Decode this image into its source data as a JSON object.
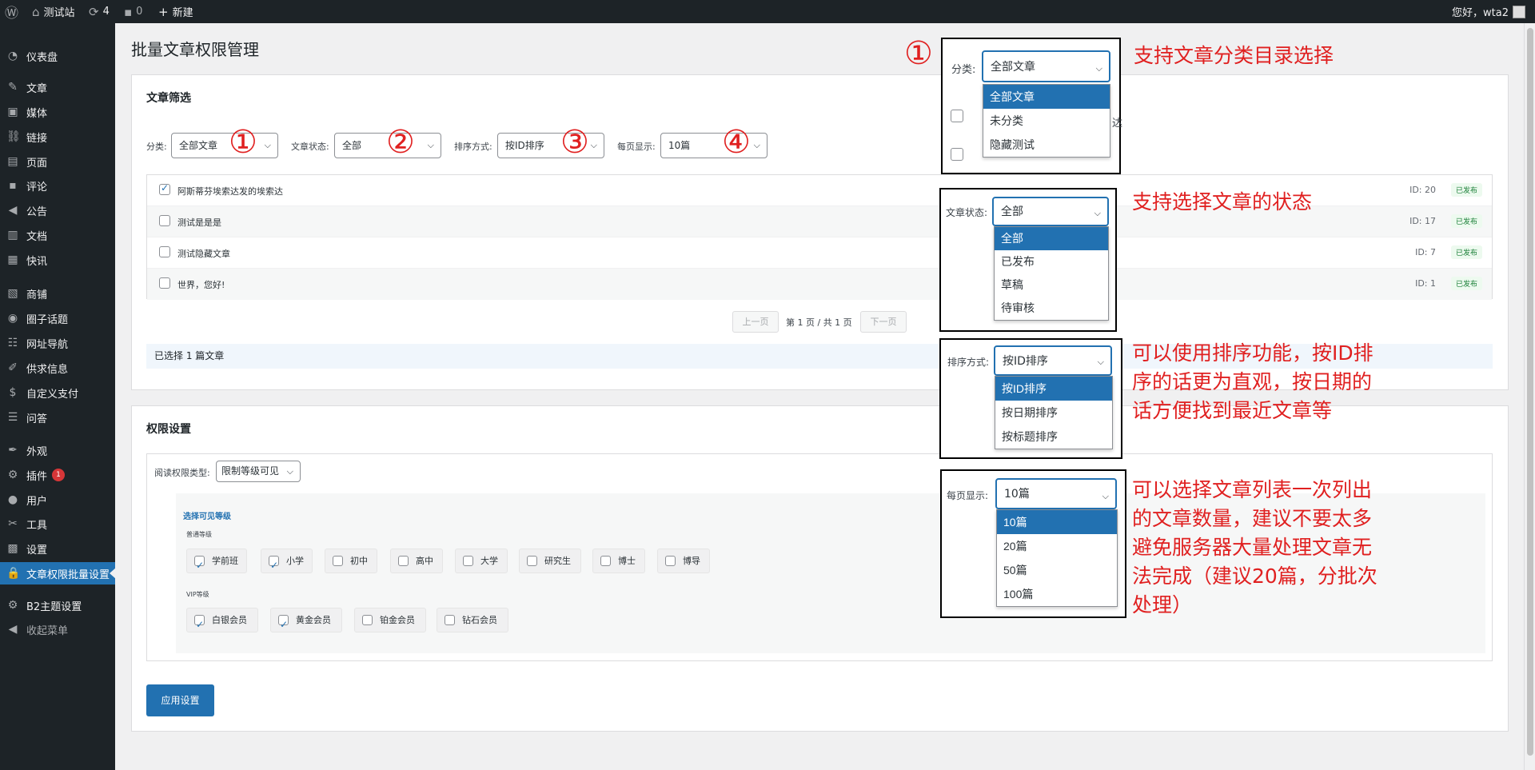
{
  "adminbar": {
    "site": "测试站",
    "updates": "4",
    "comments": "0",
    "new": "新建",
    "greeting": "您好，wta2"
  },
  "sidebar": {
    "items": [
      {
        "label": "仪表盘",
        "icon": "dashboard-icon"
      },
      {
        "label": "文章",
        "icon": "pin-icon"
      },
      {
        "label": "媒体",
        "icon": "media-icon"
      },
      {
        "label": "链接",
        "icon": "link-icon"
      },
      {
        "label": "页面",
        "icon": "page-icon"
      },
      {
        "label": "评论",
        "icon": "comment-icon"
      },
      {
        "label": "公告",
        "icon": "megaphone-icon"
      },
      {
        "label": "文档",
        "icon": "doc-icon"
      },
      {
        "label": "快讯",
        "icon": "news-icon"
      },
      {
        "label": "商铺",
        "icon": "store-icon"
      },
      {
        "label": "圈子话题",
        "icon": "circle-icon"
      },
      {
        "label": "网址导航",
        "icon": "nav-icon"
      },
      {
        "label": "供求信息",
        "icon": "supply-icon"
      },
      {
        "label": "自定义支付",
        "icon": "payment-icon"
      },
      {
        "label": "问答",
        "icon": "qa-icon"
      },
      {
        "label": "外观",
        "icon": "brush-icon"
      },
      {
        "label": "插件",
        "icon": "plugin-icon",
        "badge": "1"
      },
      {
        "label": "用户",
        "icon": "user-icon"
      },
      {
        "label": "工具",
        "icon": "wrench-icon"
      },
      {
        "label": "设置",
        "icon": "settings-icon"
      },
      {
        "label": "文章权限批量设置",
        "icon": "lock-icon"
      },
      {
        "label": "B2主题设置",
        "icon": "gear-icon"
      },
      {
        "label": "收起菜单",
        "icon": "collapse-icon"
      }
    ]
  },
  "page": {
    "title": "批量文章权限管理"
  },
  "filter": {
    "title": "文章筛选",
    "category_label": "分类:",
    "category_value": "全部文章",
    "status_label": "文章状态:",
    "status_value": "全部",
    "sort_label": "排序方式:",
    "sort_value": "按ID排序",
    "perpage_label": "每页显示:",
    "perpage_value": "10篇",
    "markers": [
      "①",
      "②",
      "③",
      "④"
    ]
  },
  "posts": [
    {
      "title": "阿斯蒂芬埃索达发的埃索达",
      "id": "ID: 20",
      "status": "已发布",
      "checked": true
    },
    {
      "title": "测试是是是",
      "id": "ID: 17",
      "status": "已发布",
      "checked": false
    },
    {
      "title": "测试隐藏文章",
      "id": "ID: 7",
      "status": "已发布",
      "checked": false
    },
    {
      "title": "世界，您好!",
      "id": "ID: 1",
      "status": "已发布",
      "checked": false
    }
  ],
  "pagination": {
    "prev": "上一页",
    "info": "第 1 页 / 共 1 页",
    "next": "下一页"
  },
  "selected_info": "已选择 1 篇文章",
  "perm": {
    "title": "权限设置",
    "type_label": "阅读权限类型:",
    "type_value": "限制等级可见",
    "levels_title": "选择可见等级",
    "normal_title": "普通等级",
    "normal": [
      {
        "label": "学前班",
        "checked": true
      },
      {
        "label": "小学",
        "checked": true
      },
      {
        "label": "初中",
        "checked": false
      },
      {
        "label": "高中",
        "checked": false
      },
      {
        "label": "大学",
        "checked": false
      },
      {
        "label": "研究生",
        "checked": false
      },
      {
        "label": "博士",
        "checked": false
      },
      {
        "label": "博导",
        "checked": false
      }
    ],
    "vip_title": "VIP等级",
    "vip": [
      {
        "label": "白银会员",
        "checked": true
      },
      {
        "label": "黄金会员",
        "checked": true
      },
      {
        "label": "铂金会员",
        "checked": false
      },
      {
        "label": "钻石会员",
        "checked": false
      }
    ],
    "apply": "应用设置"
  },
  "callouts": {
    "cat": {
      "marker": "①",
      "label": "分类:",
      "value": "全部文章",
      "options": [
        "全部文章",
        "未分类",
        "隐藏测试"
      ],
      "peek": "达",
      "note": "支持文章分类目录选择"
    },
    "status": {
      "label": "文章状态:",
      "value": "全部",
      "options": [
        "全部",
        "已发布",
        "草稿",
        "待审核"
      ],
      "note": "支持选择文章的状态"
    },
    "sort": {
      "label": "排序方式:",
      "value": "按ID排序",
      "options": [
        "按ID排序",
        "按日期排序",
        "按标题排序"
      ],
      "note": [
        "可以使用排序功能，按ID排",
        "序的话更为直观，按日期的",
        "话方便找到最近文章等"
      ]
    },
    "perpage": {
      "label": "每页显示:",
      "value": "10篇",
      "options": [
        "10篇",
        "20篇",
        "50篇",
        "100篇"
      ],
      "note": [
        "可以选择文章列表一次列出",
        "的文章数量，建议不要太多",
        "避免服务器大量处理文章无",
        "法完成（建议20篇，分批次",
        "处理）"
      ]
    }
  },
  "colors": {
    "accent": "#2271b1",
    "annotation": "#e02020",
    "sidebar": "#1d2327"
  }
}
